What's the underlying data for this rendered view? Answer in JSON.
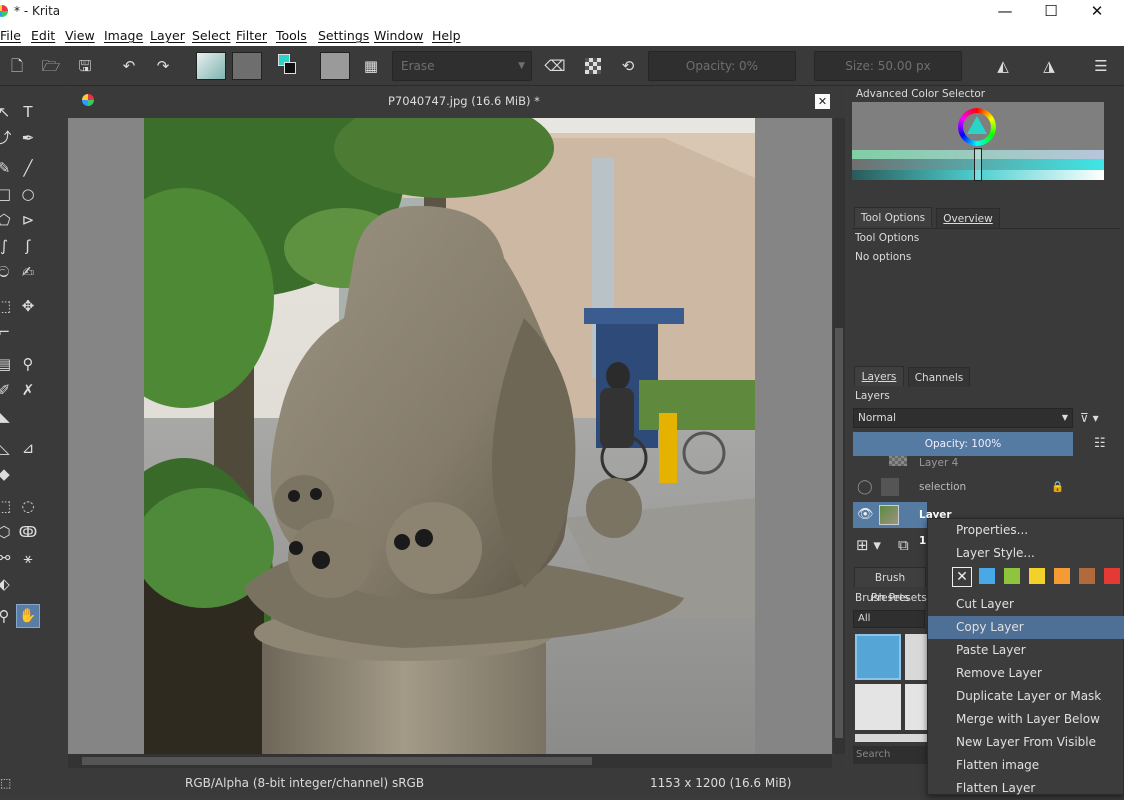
{
  "window": {
    "title": "* - Krita",
    "minimize": "—",
    "maximize": "☐",
    "close": "✕"
  },
  "menubar": {
    "items": [
      "File",
      "Edit",
      "View",
      "Image",
      "Layer",
      "Select",
      "Filter",
      "Tools",
      "Settings",
      "Window",
      "Help"
    ]
  },
  "toolbar": {
    "blend_mode": "Erase",
    "opacity": "Opacity: 0%",
    "size": "Size: 50.00 px"
  },
  "document": {
    "tab_title": "P7040747.jpg (16.6 MiB) *"
  },
  "color_selector": {
    "title": "Advanced Color Selector",
    "accent_cyan": "#3fe6e6",
    "accent_green": "#9fdcc0"
  },
  "tool_options": {
    "tabs": [
      "Tool Options",
      "Overview"
    ],
    "title": "Tool Options",
    "message": "No options"
  },
  "layers": {
    "tabs": [
      "Layers",
      "Channels"
    ],
    "title": "Layers",
    "blend_mode": "Normal",
    "opacity": "Opacity:  100%",
    "rows": [
      {
        "name": "Layer 4"
      },
      {
        "name": "selection"
      },
      {
        "name": "Layer 1"
      }
    ]
  },
  "brush_presets": {
    "tab": "Brush Presets",
    "title": "Brush Presets",
    "filter": "All",
    "search_placeholder": "Search"
  },
  "statusbar": {
    "colorspace": "RGB/Alpha (8-bit integer/channel)  sRGB",
    "dimensions": "1153 x 1200 (16.6 MiB)"
  },
  "context_menu": {
    "items": [
      {
        "label": "Properties...",
        "highlighted": false
      },
      {
        "label": "Layer Style...",
        "highlighted": false
      },
      {
        "label": "Cut Layer",
        "highlighted": false
      },
      {
        "label": "Copy Layer",
        "highlighted": true
      },
      {
        "label": "Paste Layer",
        "highlighted": false
      },
      {
        "label": "Remove Layer",
        "highlighted": false
      },
      {
        "label": "Duplicate Layer or Mask",
        "highlighted": false
      },
      {
        "label": "Merge with Layer Below",
        "highlighted": false
      },
      {
        "label": "New Layer From Visible",
        "highlighted": false
      },
      {
        "label": "Flatten image",
        "highlighted": false
      },
      {
        "label": "Flatten Layer",
        "highlighted": false
      }
    ],
    "color_labels": [
      "#48a9e6",
      "#8fc43d",
      "#f3d12b",
      "#f49b35",
      "#b06a3e",
      "#e53935"
    ]
  }
}
